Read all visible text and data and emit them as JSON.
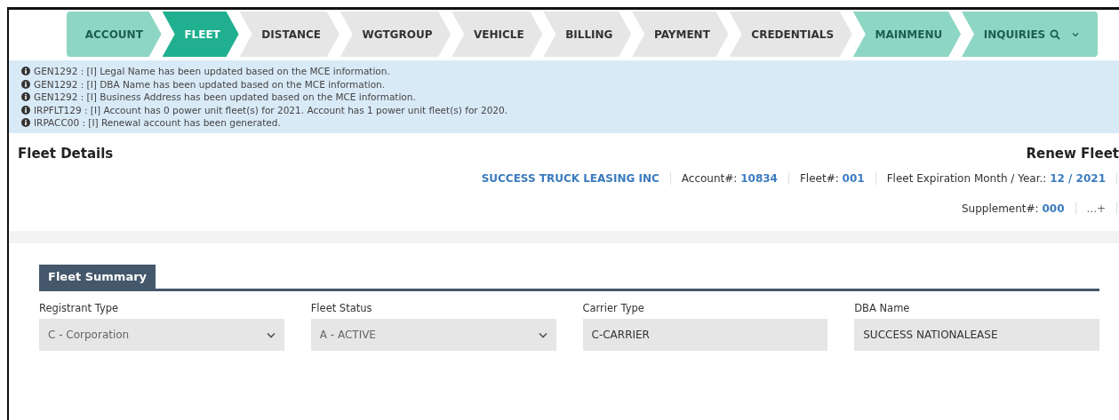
{
  "steps": [
    {
      "label": "ACCOUNT",
      "selected": false,
      "completed": true,
      "kind": "step"
    },
    {
      "label": "FLEET",
      "selected": true,
      "completed": false,
      "kind": "step"
    },
    {
      "label": "DISTANCE",
      "selected": false,
      "completed": false,
      "kind": "step"
    },
    {
      "label": "WGTGROUP",
      "selected": false,
      "completed": false,
      "kind": "step"
    },
    {
      "label": "VEHICLE",
      "selected": false,
      "completed": false,
      "kind": "step"
    },
    {
      "label": "BILLING",
      "selected": false,
      "completed": false,
      "kind": "step"
    },
    {
      "label": "PAYMENT",
      "selected": false,
      "completed": false,
      "kind": "step"
    },
    {
      "label": "CREDENTIALS",
      "selected": false,
      "completed": false,
      "kind": "step"
    },
    {
      "label": "MAINMENU",
      "selected": false,
      "completed": true,
      "kind": "step"
    },
    {
      "label": "INQUIRIES",
      "selected": false,
      "completed": true,
      "kind": "menu"
    }
  ],
  "messages": [
    "GEN1292 : [I] Legal Name has been updated based on the MCE information.",
    "GEN1292 : [I] DBA Name has been updated based on the MCE information.",
    "GEN1292 : [I] Business Address has been updated based on the MCE information.",
    "IRPFLT129 : [I] Account has 0 power unit fleet(s) for 2021. Account has 1 power unit fleet(s) for 2020.",
    "IRPACC00 : [I] Renewal account has been generated."
  ],
  "header": {
    "title": "Fleet Details",
    "action": "Renew Fleet",
    "carrier": "SUCCESS TRUCK LEASING INC",
    "info": [
      {
        "label": "Account#:",
        "value": "10834"
      },
      {
        "label": "Fleet#:",
        "value": "001"
      },
      {
        "label": "Fleet Expiration Month / Year.:",
        "value": "12 / 2021"
      }
    ],
    "info2": [
      {
        "label": "Supplement#:",
        "value": "000"
      }
    ],
    "more": "...+"
  },
  "summary": {
    "tab": "Fleet Summary",
    "fields": [
      {
        "label": "Registrant Type",
        "value": "C - Corporation",
        "kind": "select"
      },
      {
        "label": "Fleet Status",
        "value": "A - ACTIVE",
        "kind": "select"
      },
      {
        "label": "Carrier Type",
        "value": "C-CARRIER",
        "kind": "text"
      },
      {
        "label": "DBA Name",
        "value": "SUCCESS NATIONALEASE",
        "kind": "text"
      }
    ]
  }
}
